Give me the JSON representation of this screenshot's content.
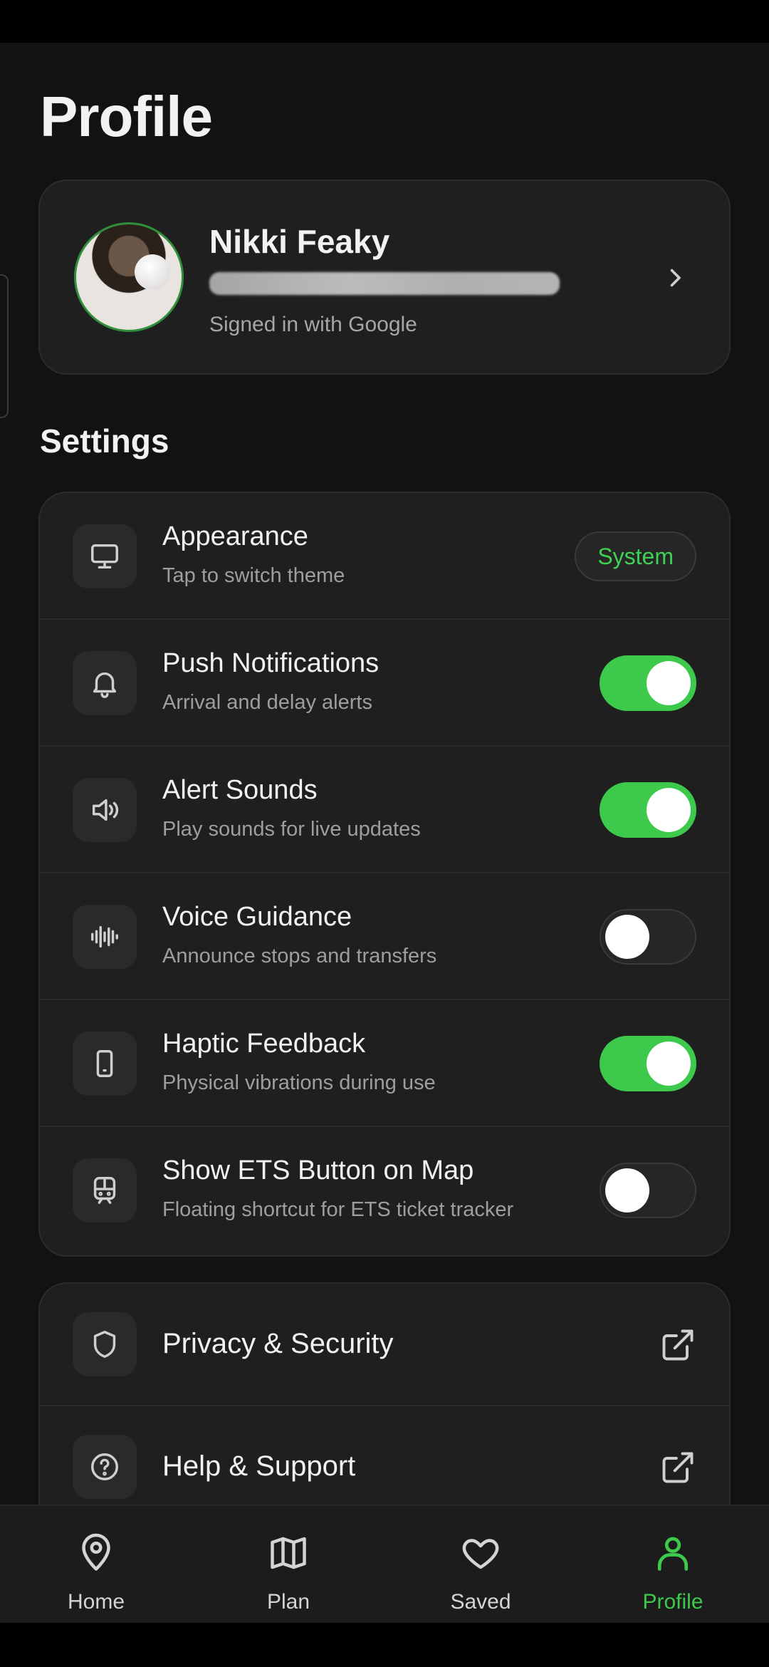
{
  "page": {
    "title": "Profile"
  },
  "profile": {
    "name": "Nikki Feaky",
    "subtitle": "Signed in with Google"
  },
  "settings": {
    "section_title": "Settings",
    "items": [
      {
        "title": "Appearance",
        "subtitle": "Tap to switch theme",
        "control": "pill",
        "value": "System",
        "icon": "monitor-icon"
      },
      {
        "title": "Push Notifications",
        "subtitle": "Arrival and delay alerts",
        "control": "toggle",
        "on": true,
        "icon": "bell-icon"
      },
      {
        "title": "Alert Sounds",
        "subtitle": "Play sounds for live updates",
        "control": "toggle",
        "on": true,
        "icon": "speaker-icon"
      },
      {
        "title": "Voice Guidance",
        "subtitle": "Announce stops and transfers",
        "control": "toggle",
        "on": false,
        "icon": "waveform-icon"
      },
      {
        "title": "Haptic Feedback",
        "subtitle": "Physical vibrations during use",
        "control": "toggle",
        "on": true,
        "icon": "phone-icon"
      },
      {
        "title": "Show ETS Button on Map",
        "subtitle": "Floating shortcut for ETS ticket tracker",
        "control": "toggle",
        "on": false,
        "icon": "train-icon"
      }
    ]
  },
  "links": [
    {
      "title": "Privacy & Security",
      "icon": "shield-icon"
    },
    {
      "title": "Help & Support",
      "icon": "help-circle-icon"
    }
  ],
  "tabs": [
    {
      "label": "Home",
      "icon": "map-pin-icon",
      "active": false
    },
    {
      "label": "Plan",
      "icon": "map-icon",
      "active": false
    },
    {
      "label": "Saved",
      "icon": "heart-icon",
      "active": false
    },
    {
      "label": "Profile",
      "icon": "user-icon",
      "active": true
    }
  ],
  "colors": {
    "accent": "#3dc94c",
    "background": "#121212",
    "card": "#1f1f1f"
  }
}
